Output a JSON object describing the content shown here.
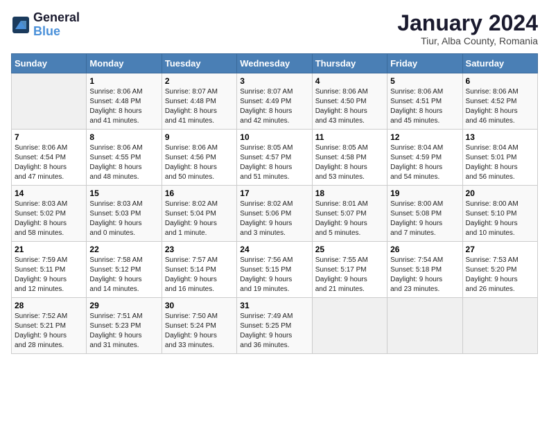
{
  "header": {
    "logo_line1": "General",
    "logo_line2": "Blue",
    "title": "January 2024",
    "subtitle": "Tiur, Alba County, Romania"
  },
  "weekdays": [
    "Sunday",
    "Monday",
    "Tuesday",
    "Wednesday",
    "Thursday",
    "Friday",
    "Saturday"
  ],
  "weeks": [
    [
      {
        "day": "",
        "info": ""
      },
      {
        "day": "1",
        "info": "Sunrise: 8:06 AM\nSunset: 4:48 PM\nDaylight: 8 hours\nand 41 minutes."
      },
      {
        "day": "2",
        "info": "Sunrise: 8:07 AM\nSunset: 4:48 PM\nDaylight: 8 hours\nand 41 minutes."
      },
      {
        "day": "3",
        "info": "Sunrise: 8:07 AM\nSunset: 4:49 PM\nDaylight: 8 hours\nand 42 minutes."
      },
      {
        "day": "4",
        "info": "Sunrise: 8:06 AM\nSunset: 4:50 PM\nDaylight: 8 hours\nand 43 minutes."
      },
      {
        "day": "5",
        "info": "Sunrise: 8:06 AM\nSunset: 4:51 PM\nDaylight: 8 hours\nand 45 minutes."
      },
      {
        "day": "6",
        "info": "Sunrise: 8:06 AM\nSunset: 4:52 PM\nDaylight: 8 hours\nand 46 minutes."
      }
    ],
    [
      {
        "day": "7",
        "info": "Sunrise: 8:06 AM\nSunset: 4:54 PM\nDaylight: 8 hours\nand 47 minutes."
      },
      {
        "day": "8",
        "info": "Sunrise: 8:06 AM\nSunset: 4:55 PM\nDaylight: 8 hours\nand 48 minutes."
      },
      {
        "day": "9",
        "info": "Sunrise: 8:06 AM\nSunset: 4:56 PM\nDaylight: 8 hours\nand 50 minutes."
      },
      {
        "day": "10",
        "info": "Sunrise: 8:05 AM\nSunset: 4:57 PM\nDaylight: 8 hours\nand 51 minutes."
      },
      {
        "day": "11",
        "info": "Sunrise: 8:05 AM\nSunset: 4:58 PM\nDaylight: 8 hours\nand 53 minutes."
      },
      {
        "day": "12",
        "info": "Sunrise: 8:04 AM\nSunset: 4:59 PM\nDaylight: 8 hours\nand 54 minutes."
      },
      {
        "day": "13",
        "info": "Sunrise: 8:04 AM\nSunset: 5:01 PM\nDaylight: 8 hours\nand 56 minutes."
      }
    ],
    [
      {
        "day": "14",
        "info": "Sunrise: 8:03 AM\nSunset: 5:02 PM\nDaylight: 8 hours\nand 58 minutes."
      },
      {
        "day": "15",
        "info": "Sunrise: 8:03 AM\nSunset: 5:03 PM\nDaylight: 9 hours\nand 0 minutes."
      },
      {
        "day": "16",
        "info": "Sunrise: 8:02 AM\nSunset: 5:04 PM\nDaylight: 9 hours\nand 1 minute."
      },
      {
        "day": "17",
        "info": "Sunrise: 8:02 AM\nSunset: 5:06 PM\nDaylight: 9 hours\nand 3 minutes."
      },
      {
        "day": "18",
        "info": "Sunrise: 8:01 AM\nSunset: 5:07 PM\nDaylight: 9 hours\nand 5 minutes."
      },
      {
        "day": "19",
        "info": "Sunrise: 8:00 AM\nSunset: 5:08 PM\nDaylight: 9 hours\nand 7 minutes."
      },
      {
        "day": "20",
        "info": "Sunrise: 8:00 AM\nSunset: 5:10 PM\nDaylight: 9 hours\nand 10 minutes."
      }
    ],
    [
      {
        "day": "21",
        "info": "Sunrise: 7:59 AM\nSunset: 5:11 PM\nDaylight: 9 hours\nand 12 minutes."
      },
      {
        "day": "22",
        "info": "Sunrise: 7:58 AM\nSunset: 5:12 PM\nDaylight: 9 hours\nand 14 minutes."
      },
      {
        "day": "23",
        "info": "Sunrise: 7:57 AM\nSunset: 5:14 PM\nDaylight: 9 hours\nand 16 minutes."
      },
      {
        "day": "24",
        "info": "Sunrise: 7:56 AM\nSunset: 5:15 PM\nDaylight: 9 hours\nand 19 minutes."
      },
      {
        "day": "25",
        "info": "Sunrise: 7:55 AM\nSunset: 5:17 PM\nDaylight: 9 hours\nand 21 minutes."
      },
      {
        "day": "26",
        "info": "Sunrise: 7:54 AM\nSunset: 5:18 PM\nDaylight: 9 hours\nand 23 minutes."
      },
      {
        "day": "27",
        "info": "Sunrise: 7:53 AM\nSunset: 5:20 PM\nDaylight: 9 hours\nand 26 minutes."
      }
    ],
    [
      {
        "day": "28",
        "info": "Sunrise: 7:52 AM\nSunset: 5:21 PM\nDaylight: 9 hours\nand 28 minutes."
      },
      {
        "day": "29",
        "info": "Sunrise: 7:51 AM\nSunset: 5:23 PM\nDaylight: 9 hours\nand 31 minutes."
      },
      {
        "day": "30",
        "info": "Sunrise: 7:50 AM\nSunset: 5:24 PM\nDaylight: 9 hours\nand 33 minutes."
      },
      {
        "day": "31",
        "info": "Sunrise: 7:49 AM\nSunset: 5:25 PM\nDaylight: 9 hours\nand 36 minutes."
      },
      {
        "day": "",
        "info": ""
      },
      {
        "day": "",
        "info": ""
      },
      {
        "day": "",
        "info": ""
      }
    ]
  ]
}
